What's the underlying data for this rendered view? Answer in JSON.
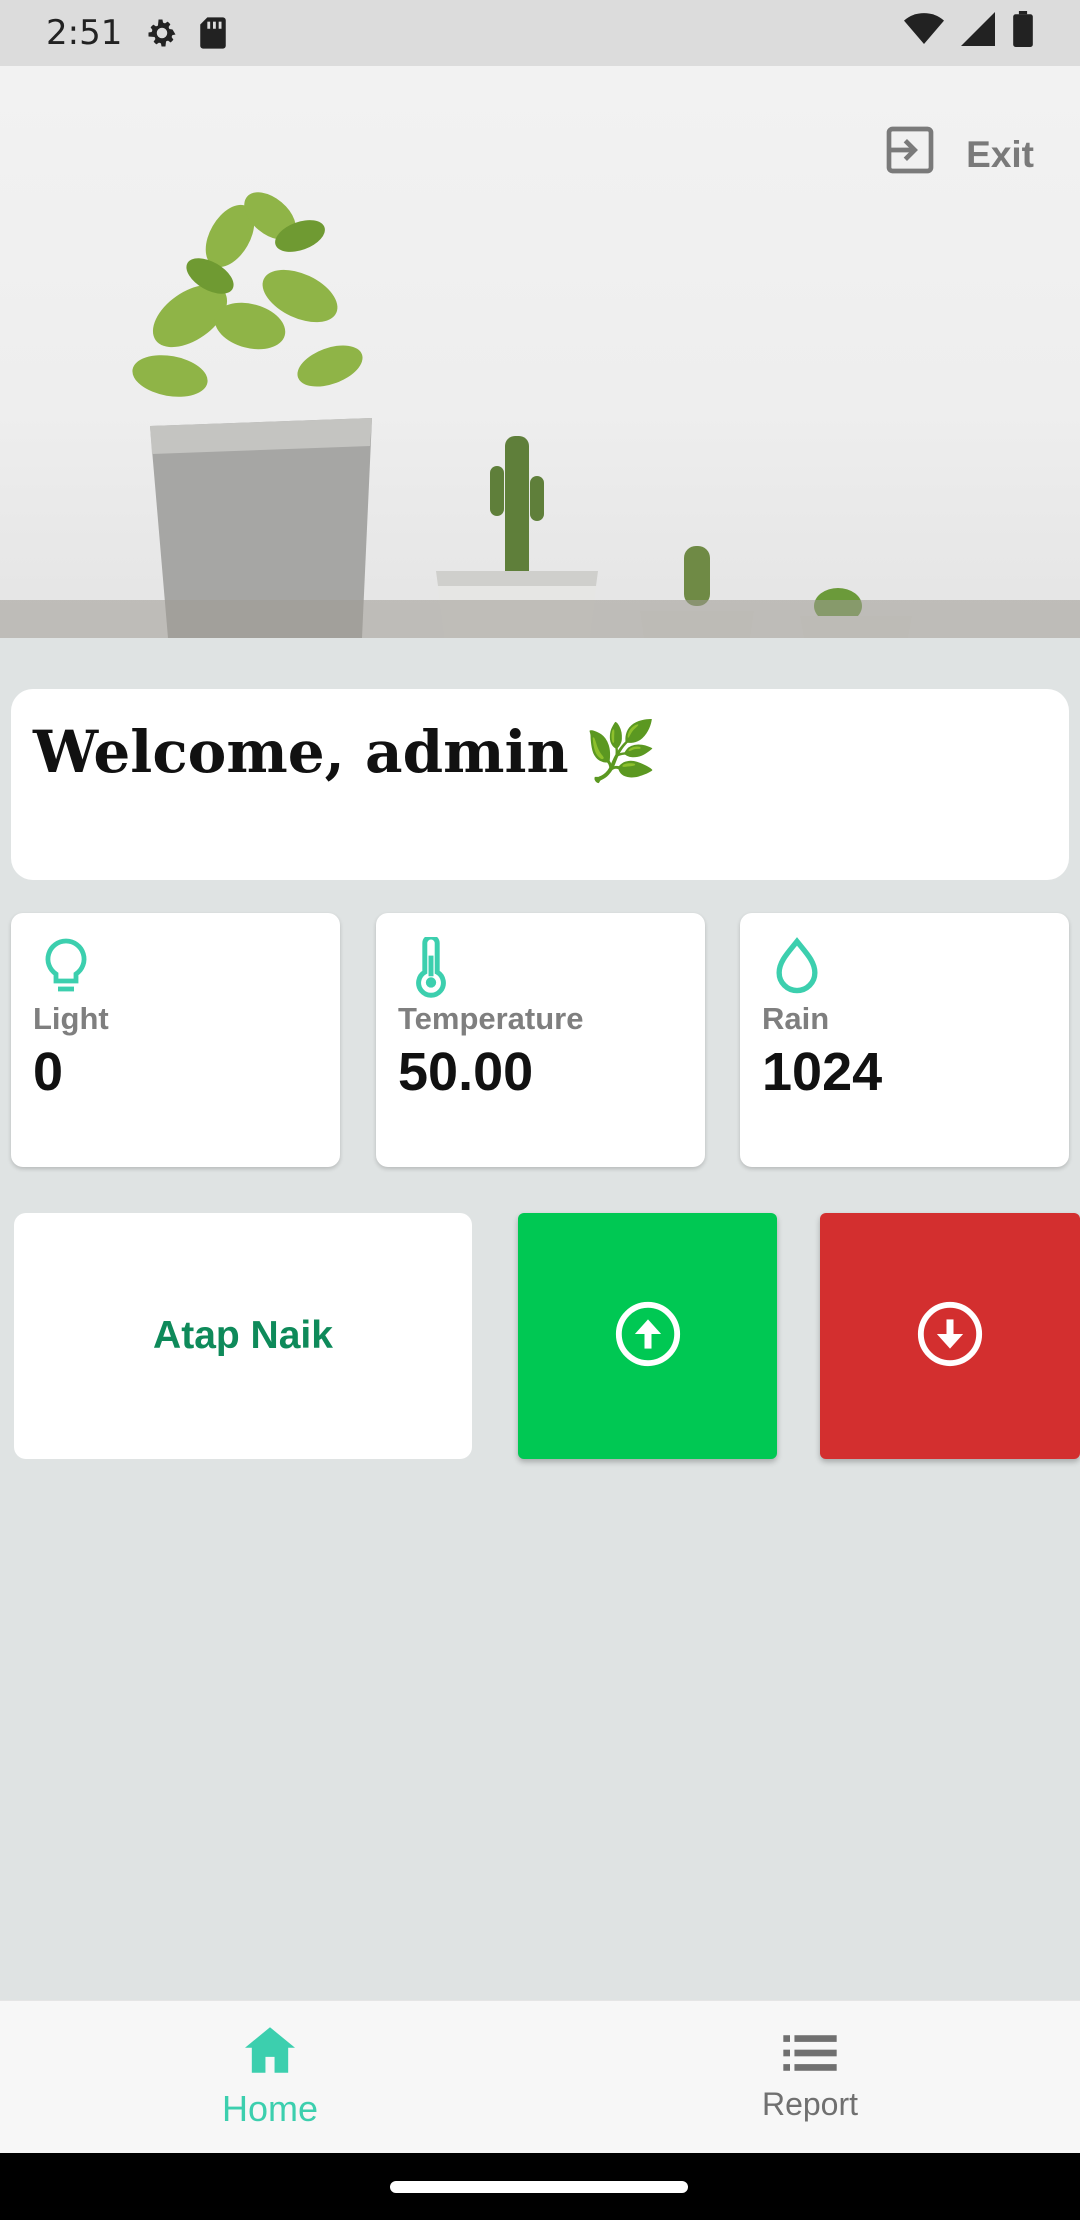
{
  "status_bar": {
    "time": "2:51",
    "icons": [
      "settings-gear-icon",
      "sd-card-icon",
      "wifi-icon",
      "signal-icon",
      "battery-icon"
    ]
  },
  "header": {
    "exit_label": "Exit",
    "exit_icon": "exit-icon"
  },
  "welcome": {
    "text": "Welcome, admin",
    "emoji": "🌿"
  },
  "sensors": [
    {
      "label": "Light",
      "value": "0",
      "icon": "lightbulb-icon"
    },
    {
      "label": "Temperature",
      "value": "50.00",
      "icon": "thermometer-icon"
    },
    {
      "label": "Rain",
      "value": "1024",
      "icon": "water-drop-icon"
    }
  ],
  "controls": {
    "roof_status": "Atap Naik",
    "up_icon": "arrow-up-circle-icon",
    "down_icon": "arrow-down-circle-icon"
  },
  "nav": {
    "items": [
      {
        "label": "Home",
        "icon": "home-icon",
        "active": true
      },
      {
        "label": "Report",
        "icon": "list-icon",
        "active": false
      }
    ]
  },
  "colors": {
    "accent": "#3ccfae",
    "up_button": "#00c853",
    "down_button": "#d32f2f",
    "roof_status_text": "#0e8a5a",
    "background": "#dfe3e3"
  }
}
